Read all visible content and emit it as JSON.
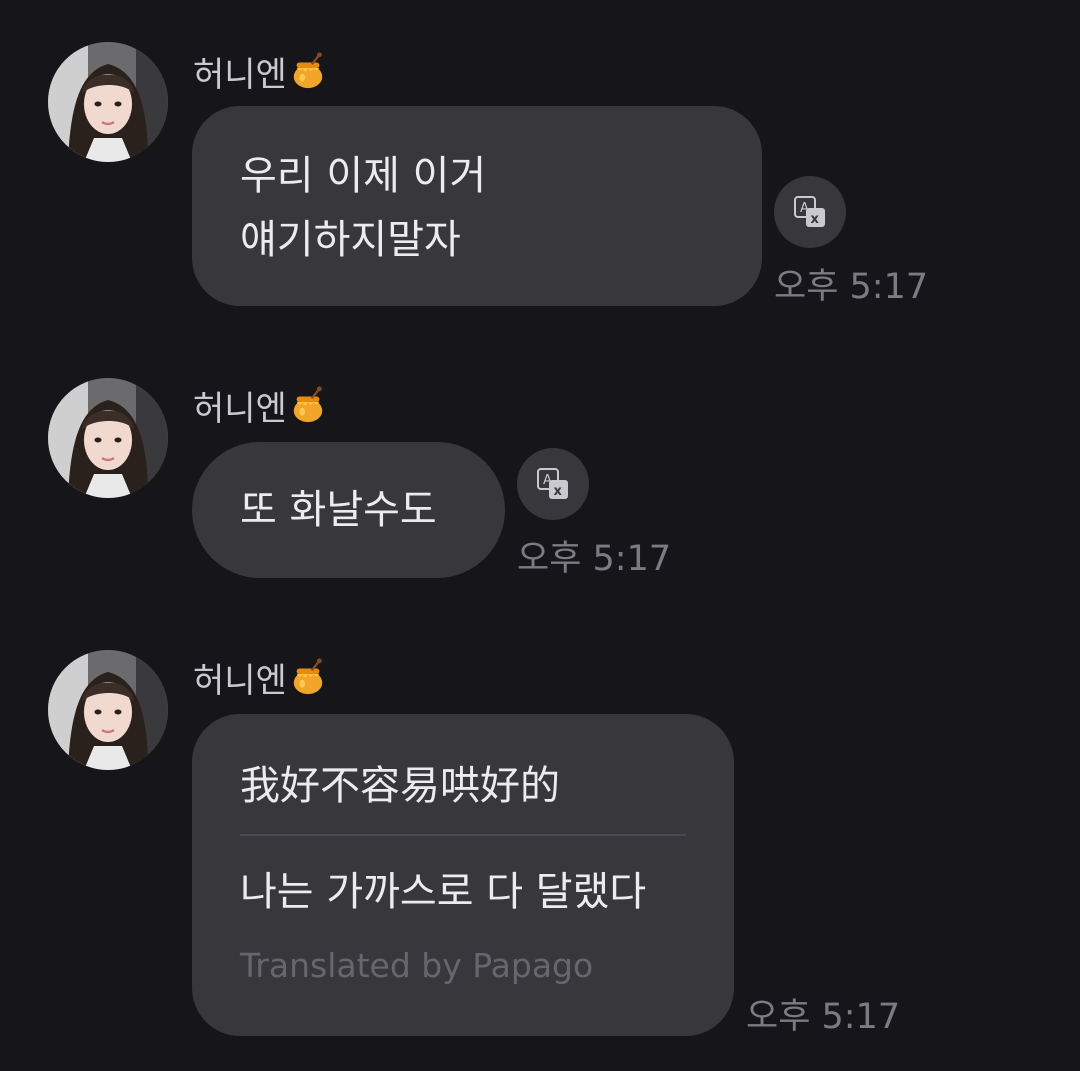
{
  "messages": [
    {
      "sender": "허니엔",
      "lines": [
        "우리 이제 이거",
        "얘기하지말자"
      ],
      "time": "오후 5:17",
      "has_translate_button": true
    },
    {
      "sender": "허니엔",
      "lines": [
        "또 화날수도"
      ],
      "time": "오후 5:17",
      "has_translate_button": true
    },
    {
      "sender": "허니엔",
      "original": "我好不容易哄好的",
      "translation": "나는 가까스로 다 달랬다",
      "translated_by": "Translated by Papago",
      "time": "오후 5:17"
    }
  ],
  "icons": {
    "translate": "translate-icon",
    "honey_pot": "honey-pot-emoji"
  },
  "colors": {
    "background": "#16161a",
    "bubble": "#37373c",
    "text": "#ececef",
    "sender": "#c9c9cf",
    "time": "#7b7b82",
    "credit": "#66666d"
  }
}
